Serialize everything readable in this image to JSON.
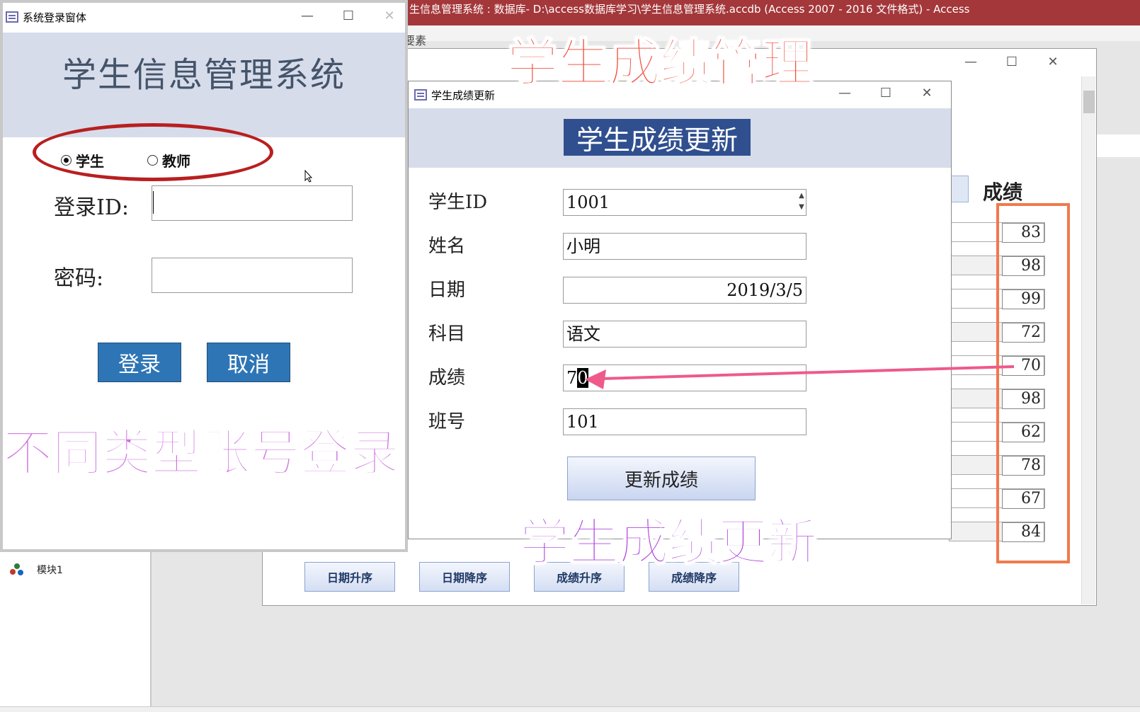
{
  "access": {
    "title": "生信息管理系统 : 数据库- D:\\access数据库学习\\学生信息管理系统.accdb (Access 2007 - 2016 文件格式)  -  Access",
    "search_hint": "要素",
    "nav_module_label": "模块1"
  },
  "grade_form": {
    "score_header": "成绩",
    "scores": [
      "83",
      "98",
      "99",
      "72",
      "70",
      "98",
      "62",
      "78",
      "67",
      "84"
    ],
    "sort_buttons": [
      "日期升序",
      "日期降序",
      "成绩升序",
      "成绩降序"
    ]
  },
  "login_form": {
    "window_title": "系统登录窗体",
    "title": "学生信息管理系统",
    "radio_student": "学生",
    "radio_teacher": "教师",
    "selected_role": "学生",
    "id_label": "登录ID:",
    "password_label": "密码:",
    "id_value": "",
    "password_value": "",
    "login_button": "登录",
    "cancel_button": "取消"
  },
  "update_form": {
    "window_title": "学生成绩更新",
    "title": "学生成绩更新",
    "fields": {
      "student_id_label": "学生ID",
      "student_id_value": "1001",
      "name_label": "姓名",
      "name_value": "小明",
      "date_label": "日期",
      "date_value": "2019/3/5",
      "subject_label": "科目",
      "subject_value": "语文",
      "score_label": "成绩",
      "score_value_prefix": "7",
      "score_value_selected": "0",
      "class_label": "班号",
      "class_value": "101"
    },
    "update_button": "更新成绩"
  },
  "captions": {
    "manage": "学生成绩管理",
    "login": "不同类型账号登录",
    "update": "学生成绩更新"
  },
  "colors": {
    "access_red": "#a4373a",
    "button_blue": "#2e75b6",
    "header_band": "#d6dcea",
    "highlight_orange": "#f07a4c",
    "ellipse_red": "#b81f1f",
    "arrow_pink": "#ee5a8a"
  },
  "window_controls": {
    "minimize": "—",
    "maximize": "☐",
    "close": "✕"
  }
}
